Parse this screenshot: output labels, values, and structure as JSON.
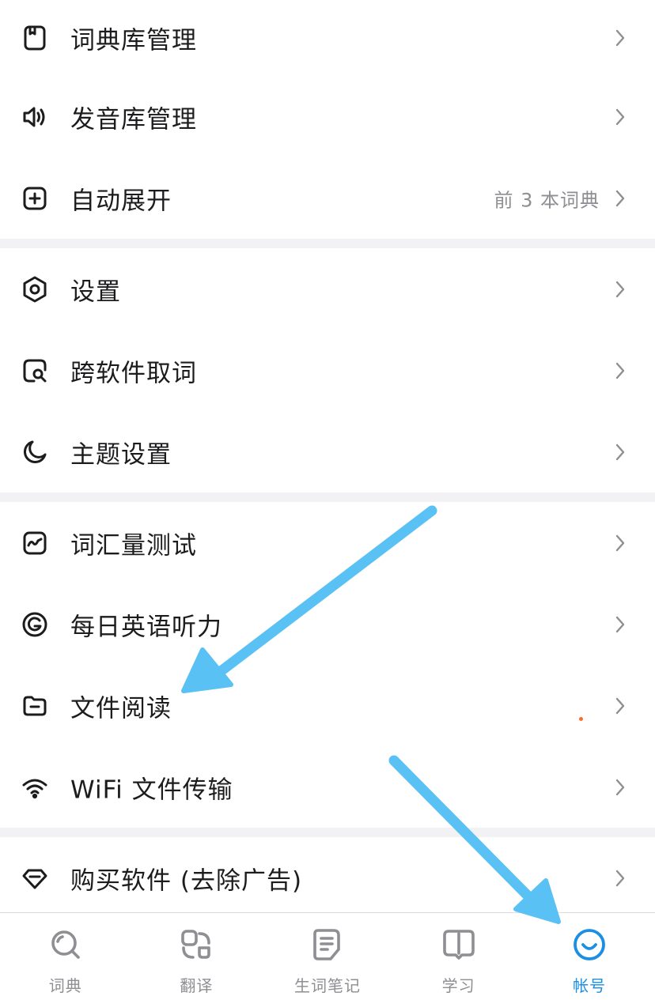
{
  "colors": {
    "accent": "#1a8fe3",
    "text": "#1c1c1e",
    "secondary": "#8e8e93",
    "separator": "#f2f2f4",
    "annotation": "#5ac1f4"
  },
  "menu": {
    "groups": [
      {
        "items": [
          {
            "label": "词典库管理",
            "icon": "dictionary-icon"
          },
          {
            "label": "发音库管理",
            "icon": "speaker-icon"
          },
          {
            "label": "自动展开",
            "icon": "plus-square-icon",
            "value": "前 3 本词典"
          }
        ]
      },
      {
        "items": [
          {
            "label": "设置",
            "icon": "hexagon-settings-icon"
          },
          {
            "label": "跨软件取词",
            "icon": "search-square-icon"
          },
          {
            "label": "主题设置",
            "icon": "moon-icon"
          }
        ]
      },
      {
        "items": [
          {
            "label": "词汇量测试",
            "icon": "chart-square-icon"
          },
          {
            "label": "每日英语听力",
            "icon": "listening-icon"
          },
          {
            "label": "文件阅读",
            "icon": "folder-icon"
          },
          {
            "label": "WiFi 文件传输",
            "icon": "wifi-icon"
          }
        ]
      },
      {
        "items": [
          {
            "label": "购买软件 (去除广告)",
            "icon": "diamond-icon"
          }
        ]
      }
    ]
  },
  "tabbar": {
    "tabs": [
      {
        "label": "词典",
        "icon": "search-icon",
        "active": false
      },
      {
        "label": "翻译",
        "icon": "translate-icon",
        "active": false
      },
      {
        "label": "生词笔记",
        "icon": "notes-icon",
        "active": false
      },
      {
        "label": "学习",
        "icon": "book-icon",
        "active": false
      },
      {
        "label": "帐号",
        "icon": "smile-icon",
        "active": true
      }
    ]
  }
}
